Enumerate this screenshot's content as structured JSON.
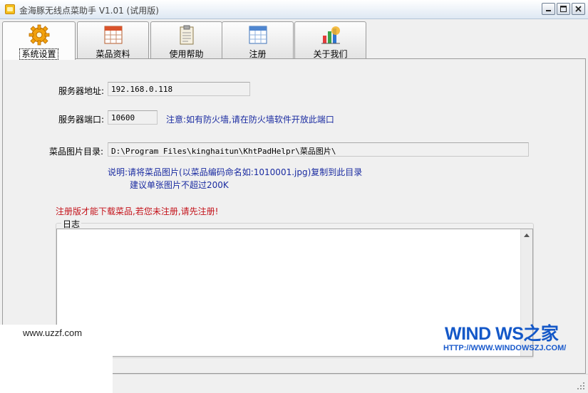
{
  "window": {
    "title": "金海豚无线点菜助手 V1.01 (试用版)"
  },
  "tabs": [
    {
      "label": "系统设置",
      "icon": "gear-icon",
      "active": true
    },
    {
      "label": "菜品资料",
      "icon": "calendar-icon",
      "active": false
    },
    {
      "label": "使用帮助",
      "icon": "clipboard-icon",
      "active": false
    },
    {
      "label": "注册",
      "icon": "calendar-grid-icon",
      "active": false
    },
    {
      "label": "关于我们",
      "icon": "chart-icon",
      "active": false
    }
  ],
  "settings": {
    "server_address_label": "服务器地址:",
    "server_address_value": "192.168.0.118",
    "server_port_label": "服务器端口:",
    "server_port_value": "10600",
    "port_note": "注意:如有防火墙,请在防火墙软件开放此端口",
    "image_dir_label": "菜品图片目录:",
    "image_dir_value": "D:\\Program Files\\kinghaitun\\KhtPadHelpr\\菜品图片\\",
    "image_note_line1": "说明:请将菜品图片(以菜品编码命名如:1010001.jpg)复制到此目录",
    "image_note_line2": "建议单张图片不超过200K",
    "register_warning": "注册版才能下载菜品,若您未注册,请先注册!"
  },
  "log": {
    "legend": "日志",
    "content": ""
  },
  "watermarks": {
    "site_left": "www.uzzf.com",
    "logo": "WIND WS之家",
    "url": "HTTP://WWW.WINDOWSZJ.COM/"
  },
  "colors": {
    "note_blue": "#1a2ba1",
    "warning_red": "#c4121a",
    "watermark_blue": "#1458c8"
  }
}
